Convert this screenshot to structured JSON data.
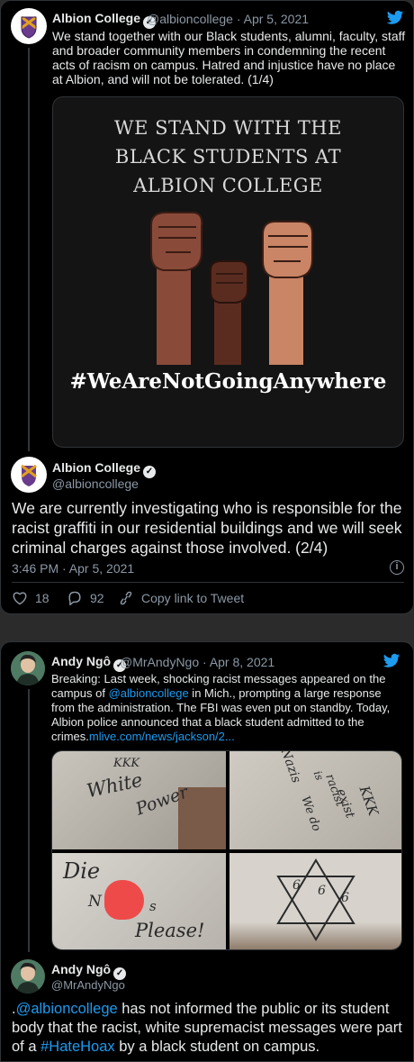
{
  "tweet1": {
    "name": "Albion College",
    "handle": "@albioncollege",
    "date": "Apr 5, 2021",
    "text": "We stand together with our Black students, alumni, faculty, staff and broader community members in condemning the recent acts of racism on campus. Hatred and injustice have no place at Albion, and will not be tolerated. (1/4)",
    "poster": {
      "line1": "WE STAND WITH THE",
      "line2": "BLACK STUDENTS AT",
      "line3": "ALBION COLLEGE",
      "hashtag": "#WeAreNotGoingAnywhere"
    }
  },
  "tweet2": {
    "name": "Albion College",
    "handle": "@albioncollege",
    "text": "We are currently investigating who is responsible for the racist graffiti in our residential buildings and we will seek criminal charges against those involved. (2/4)",
    "timestamp": "3:46 PM · Apr 5, 2021",
    "likes": "18",
    "replies": "92",
    "copy_link": "Copy link to Tweet"
  },
  "tweet3": {
    "name": "Andy Ngô",
    "handle": "@MrAndyNgo",
    "date": "Apr 8, 2021",
    "text_pre": "Breaking: Last week, shocking racist messages appeared on the campus of ",
    "mention": "@albioncollege",
    "text_mid": " in Mich., prompting a large response from the administration. The FBI was even put on standby. Today, Albion police announced that a black student admitted to the crimes.",
    "link": "mlive.com/news/jackson/2...",
    "graffiti": {
      "p1a": "KKK",
      "p1b": "White",
      "p1c": "Power",
      "p2a": "Nazis",
      "p2b": "is",
      "p2c": "racist",
      "p2d": "We do",
      "p2e": "exist",
      "p2f": "KKK",
      "p3a": "Die",
      "p3b": "N",
      "p3c": "s",
      "p3d": "Please!",
      "p4a": "6",
      "p4b": "6",
      "p4c": "6"
    }
  },
  "tweet4": {
    "name": "Andy Ngô",
    "handle": "@MrAndyNgo",
    "text_dot": ".",
    "mention": "@albioncollege",
    "text_mid": " has not informed the public or its student body that the racist, white supremacist messages were part of a ",
    "hashtag": "#HateHoax",
    "text_end": " by a black student on campus."
  },
  "colors": {
    "link": "#1d9bf0",
    "muted": "#8b98a5",
    "text": "#e7e9ea"
  },
  "icons": [
    "twitter-bird-icon",
    "verified-icon",
    "heart-icon",
    "reply-icon",
    "link-icon",
    "info-icon"
  ]
}
